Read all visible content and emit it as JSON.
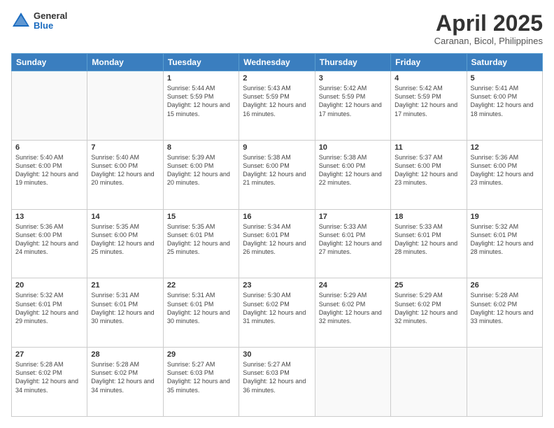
{
  "header": {
    "logo_general": "General",
    "logo_blue": "Blue",
    "month_title": "April 2025",
    "location": "Caranan, Bicol, Philippines"
  },
  "weekdays": [
    "Sunday",
    "Monday",
    "Tuesday",
    "Wednesday",
    "Thursday",
    "Friday",
    "Saturday"
  ],
  "weeks": [
    [
      {
        "day": "",
        "detail": ""
      },
      {
        "day": "",
        "detail": ""
      },
      {
        "day": "1",
        "detail": "Sunrise: 5:44 AM\nSunset: 5:59 PM\nDaylight: 12 hours and 15 minutes."
      },
      {
        "day": "2",
        "detail": "Sunrise: 5:43 AM\nSunset: 5:59 PM\nDaylight: 12 hours and 16 minutes."
      },
      {
        "day": "3",
        "detail": "Sunrise: 5:42 AM\nSunset: 5:59 PM\nDaylight: 12 hours and 17 minutes."
      },
      {
        "day": "4",
        "detail": "Sunrise: 5:42 AM\nSunset: 5:59 PM\nDaylight: 12 hours and 17 minutes."
      },
      {
        "day": "5",
        "detail": "Sunrise: 5:41 AM\nSunset: 6:00 PM\nDaylight: 12 hours and 18 minutes."
      }
    ],
    [
      {
        "day": "6",
        "detail": "Sunrise: 5:40 AM\nSunset: 6:00 PM\nDaylight: 12 hours and 19 minutes."
      },
      {
        "day": "7",
        "detail": "Sunrise: 5:40 AM\nSunset: 6:00 PM\nDaylight: 12 hours and 20 minutes."
      },
      {
        "day": "8",
        "detail": "Sunrise: 5:39 AM\nSunset: 6:00 PM\nDaylight: 12 hours and 20 minutes."
      },
      {
        "day": "9",
        "detail": "Sunrise: 5:38 AM\nSunset: 6:00 PM\nDaylight: 12 hours and 21 minutes."
      },
      {
        "day": "10",
        "detail": "Sunrise: 5:38 AM\nSunset: 6:00 PM\nDaylight: 12 hours and 22 minutes."
      },
      {
        "day": "11",
        "detail": "Sunrise: 5:37 AM\nSunset: 6:00 PM\nDaylight: 12 hours and 23 minutes."
      },
      {
        "day": "12",
        "detail": "Sunrise: 5:36 AM\nSunset: 6:00 PM\nDaylight: 12 hours and 23 minutes."
      }
    ],
    [
      {
        "day": "13",
        "detail": "Sunrise: 5:36 AM\nSunset: 6:00 PM\nDaylight: 12 hours and 24 minutes."
      },
      {
        "day": "14",
        "detail": "Sunrise: 5:35 AM\nSunset: 6:00 PM\nDaylight: 12 hours and 25 minutes."
      },
      {
        "day": "15",
        "detail": "Sunrise: 5:35 AM\nSunset: 6:01 PM\nDaylight: 12 hours and 25 minutes."
      },
      {
        "day": "16",
        "detail": "Sunrise: 5:34 AM\nSunset: 6:01 PM\nDaylight: 12 hours and 26 minutes."
      },
      {
        "day": "17",
        "detail": "Sunrise: 5:33 AM\nSunset: 6:01 PM\nDaylight: 12 hours and 27 minutes."
      },
      {
        "day": "18",
        "detail": "Sunrise: 5:33 AM\nSunset: 6:01 PM\nDaylight: 12 hours and 28 minutes."
      },
      {
        "day": "19",
        "detail": "Sunrise: 5:32 AM\nSunset: 6:01 PM\nDaylight: 12 hours and 28 minutes."
      }
    ],
    [
      {
        "day": "20",
        "detail": "Sunrise: 5:32 AM\nSunset: 6:01 PM\nDaylight: 12 hours and 29 minutes."
      },
      {
        "day": "21",
        "detail": "Sunrise: 5:31 AM\nSunset: 6:01 PM\nDaylight: 12 hours and 30 minutes."
      },
      {
        "day": "22",
        "detail": "Sunrise: 5:31 AM\nSunset: 6:01 PM\nDaylight: 12 hours and 30 minutes."
      },
      {
        "day": "23",
        "detail": "Sunrise: 5:30 AM\nSunset: 6:02 PM\nDaylight: 12 hours and 31 minutes."
      },
      {
        "day": "24",
        "detail": "Sunrise: 5:29 AM\nSunset: 6:02 PM\nDaylight: 12 hours and 32 minutes."
      },
      {
        "day": "25",
        "detail": "Sunrise: 5:29 AM\nSunset: 6:02 PM\nDaylight: 12 hours and 32 minutes."
      },
      {
        "day": "26",
        "detail": "Sunrise: 5:28 AM\nSunset: 6:02 PM\nDaylight: 12 hours and 33 minutes."
      }
    ],
    [
      {
        "day": "27",
        "detail": "Sunrise: 5:28 AM\nSunset: 6:02 PM\nDaylight: 12 hours and 34 minutes."
      },
      {
        "day": "28",
        "detail": "Sunrise: 5:28 AM\nSunset: 6:02 PM\nDaylight: 12 hours and 34 minutes."
      },
      {
        "day": "29",
        "detail": "Sunrise: 5:27 AM\nSunset: 6:03 PM\nDaylight: 12 hours and 35 minutes."
      },
      {
        "day": "30",
        "detail": "Sunrise: 5:27 AM\nSunset: 6:03 PM\nDaylight: 12 hours and 36 minutes."
      },
      {
        "day": "",
        "detail": ""
      },
      {
        "day": "",
        "detail": ""
      },
      {
        "day": "",
        "detail": ""
      }
    ]
  ]
}
